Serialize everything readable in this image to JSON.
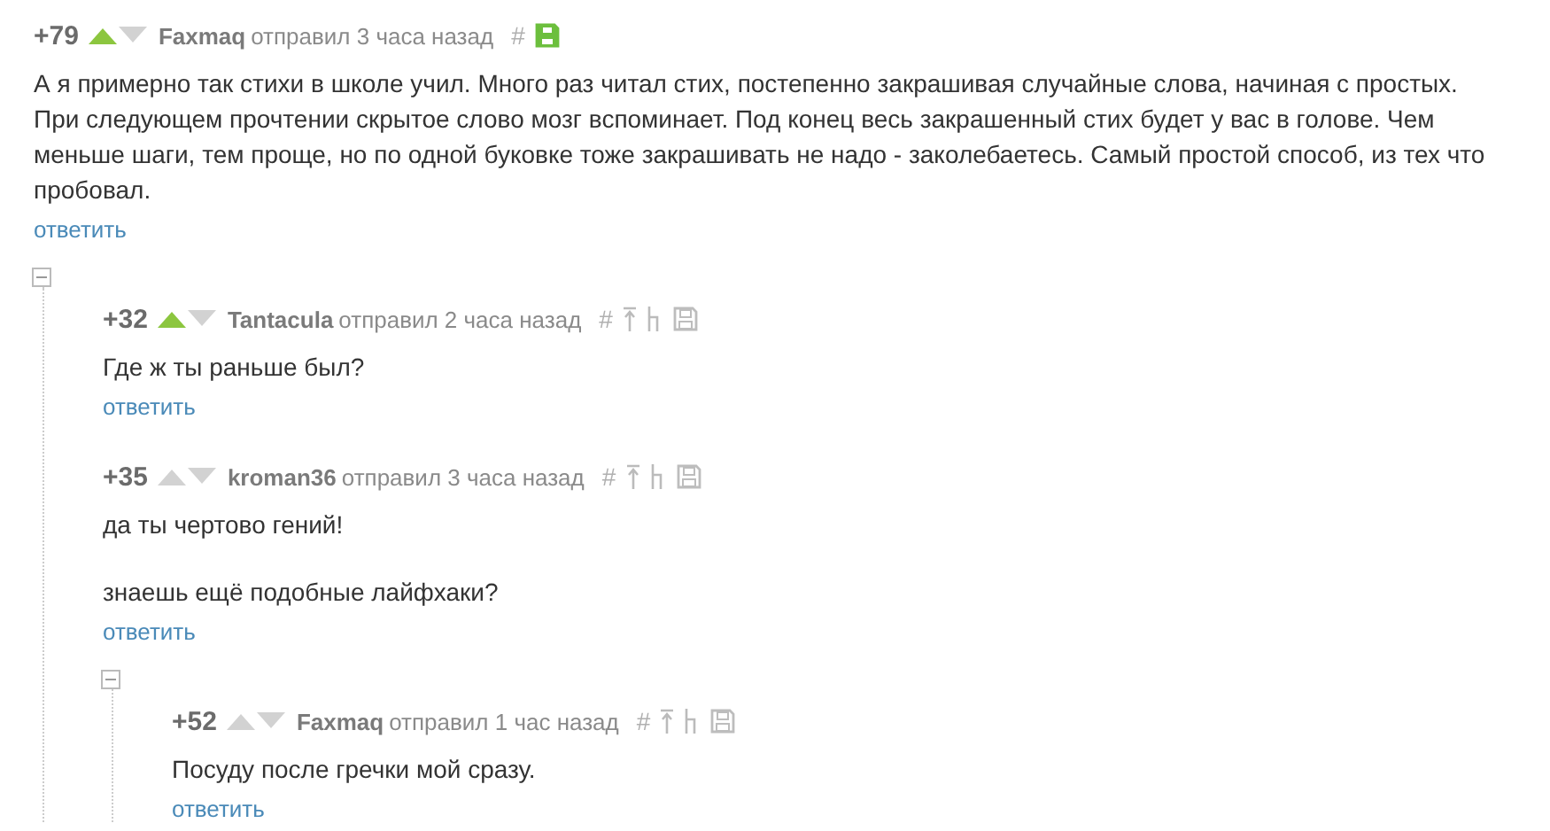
{
  "comments": [
    {
      "score": "+79",
      "upvoted": true,
      "author": "Faxmaq",
      "meta": "отправил 3 часа назад",
      "hash": "#",
      "saved": true,
      "paragraphs": [
        "А я примерно так стихи в школе учил. Много раз читал стих, постепенно закрашивая случайные слова, начиная с простых. При следующем прочтении скрытое слово мозг вспоминает. Под конец весь закрашенный стих будет у вас в голове. Чем меньше шаги, тем проще, но по одной буковке тоже закрашивать не надо - заколебаетесь. Самый простой способ, из тех что пробовал."
      ],
      "reply": "ответить",
      "expanded": true,
      "children": [
        {
          "score": "+32",
          "upvoted": true,
          "author": "Tantacula",
          "meta": "отправил 2 часа назад",
          "hash": "#",
          "saved": false,
          "paragraphs": [
            "Где ж ты раньше был?"
          ],
          "reply": "ответить"
        },
        {
          "score": "+35",
          "upvoted": false,
          "author": "kroman36",
          "meta": "отправил 3 часа назад",
          "hash": "#",
          "saved": false,
          "paragraphs": [
            "да ты чертово гений!",
            "знаешь ещё подобные лайфхаки?"
          ],
          "reply": "ответить",
          "expanded": true,
          "children": [
            {
              "score": "+52",
              "upvoted": false,
              "author": "Faxmaq",
              "meta": "отправил 1 час назад",
              "hash": "#",
              "saved": false,
              "paragraphs": [
                "Посуду после гречки мой сразу."
              ],
              "reply": "ответить"
            }
          ]
        }
      ]
    }
  ]
}
